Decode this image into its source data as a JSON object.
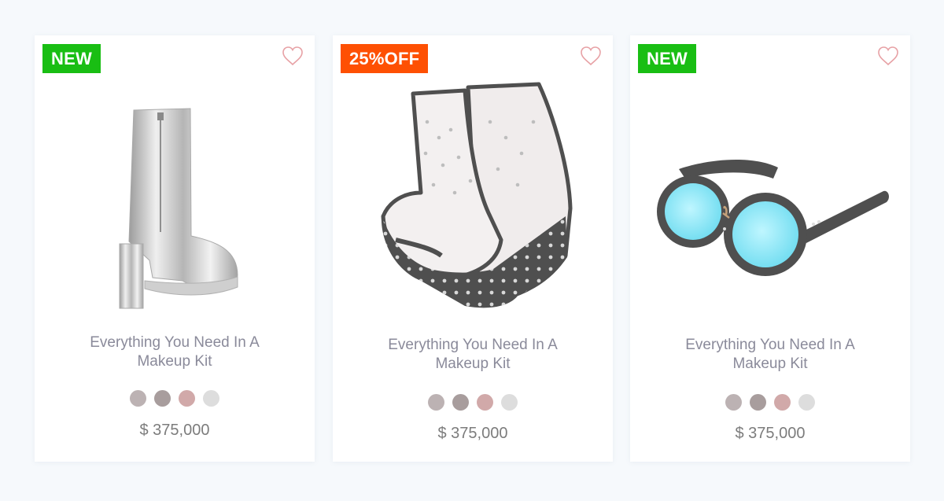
{
  "products": [
    {
      "badge": "NEW",
      "badge_color": "#19be13",
      "image": "silver-boot",
      "title": "Everything You Need In A Makeup Kit",
      "price": "$ 375,000",
      "swatch_colors": [
        "#bcb2b3",
        "#a89d9d",
        "#d1a9a9",
        "#dddddd"
      ],
      "favorite_icon": "heart-outline-icon"
    },
    {
      "badge": "25%OFF",
      "badge_color": "#fe5003",
      "image": "studded-wedge-sandal",
      "title": "Everything You Need In A Makeup Kit",
      "price": "$ 375,000",
      "swatch_colors": [
        "#bcb2b3",
        "#a89d9d",
        "#d1a9a9",
        "#dddddd"
      ],
      "favorite_icon": "heart-outline-icon"
    },
    {
      "badge": "NEW",
      "badge_color": "#19be13",
      "image": "round-sunglasses",
      "title": "Everything You Need In A Makeup Kit",
      "price": "$ 375,000",
      "swatch_colors": [
        "#bcb2b3",
        "#a89d9d",
        "#d1a9a9",
        "#dddddd"
      ],
      "favorite_icon": "heart-outline-icon"
    }
  ],
  "colors": {
    "page_background": "#f6f9fc",
    "card_background": "#ffffff",
    "heart": "#e7a1a5",
    "title_text": "#8a8a9a",
    "price_text": "#7c7c7c"
  }
}
